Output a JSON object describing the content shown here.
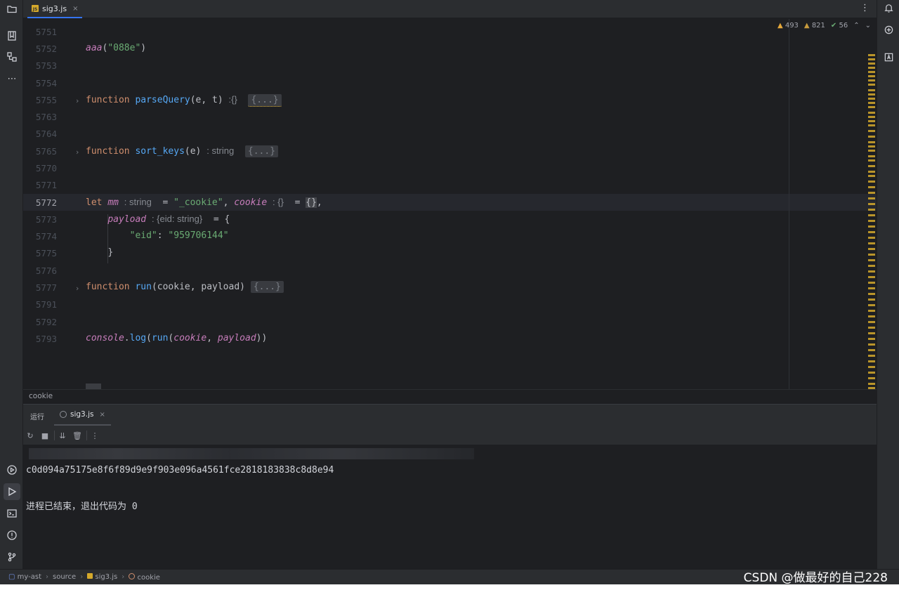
{
  "tab": {
    "filename": "sig3.js",
    "badge": "JS",
    "close": "×",
    "more": "⋮"
  },
  "inspections": {
    "warnings": "493",
    "weak_warnings": "821",
    "ok": "56",
    "up": "⌃",
    "down": "⌄"
  },
  "editor": {
    "lines": [
      {
        "num": "5751"
      },
      {
        "num": "5752",
        "call": "aaa",
        "arg": "\"088e\""
      },
      {
        "num": "5753"
      },
      {
        "num": "5754"
      },
      {
        "num": "5755",
        "kw": "function",
        "name": "parseQuery",
        "params": "(e, t)",
        "hint": ":{}",
        "fold": "{...}"
      },
      {
        "num": "5763"
      },
      {
        "num": "5764"
      },
      {
        "num": "5765",
        "kw": "function",
        "name": "sort_keys",
        "params": "(e)",
        "hint": ": string",
        "fold": "{...}"
      },
      {
        "num": "5770"
      },
      {
        "num": "5771"
      },
      {
        "num": "5772",
        "kw": "let",
        "var1": "mm",
        "hint1": ": string",
        "eq1": "= ",
        "str1": "\"_cookie\"",
        "comma": ", ",
        "var2": "cookie",
        "hint2": ": {}",
        "eq2": "= ",
        "val2": "{}",
        "tail": ","
      },
      {
        "num": "5773",
        "var": "payload",
        "hint": ": {eid: string}",
        "eq": "= {"
      },
      {
        "num": "5774",
        "key": "\"eid\"",
        "colon": ": ",
        "val": "\"959706144\""
      },
      {
        "num": "5775",
        "close": "}"
      },
      {
        "num": "5776"
      },
      {
        "num": "5777",
        "kw": "function",
        "name": "run",
        "params": "(cookie, payload)",
        "fold": "{...}"
      },
      {
        "num": "5791"
      },
      {
        "num": "5792"
      },
      {
        "num": "5793",
        "obj": "console",
        "method": "log",
        "fn": "run",
        "a1": "cookie",
        "a2": "payload"
      }
    ]
  },
  "breadcrumb_hint": "cookie",
  "tool_window": {
    "title": "运行",
    "run_tab": "sig3.js",
    "output_hash": "c0d094a75175e8f6f89d9e9f903e096a4561fce2818183838c8d8e94",
    "exit_message": "进程已结束，退出代码为 0"
  },
  "status_bar": {
    "project": "my-ast",
    "folder": "source",
    "file": "sig3.js",
    "symbol": "cookie"
  },
  "watermark": "CSDN @做最好的自己228",
  "colors": {
    "accent": "#3574f0",
    "keyword": "#cf8e6d",
    "function": "#56a8f5",
    "string": "#6aab73",
    "italic_var": "#c77dbb",
    "warning": "#d5a92b"
  }
}
